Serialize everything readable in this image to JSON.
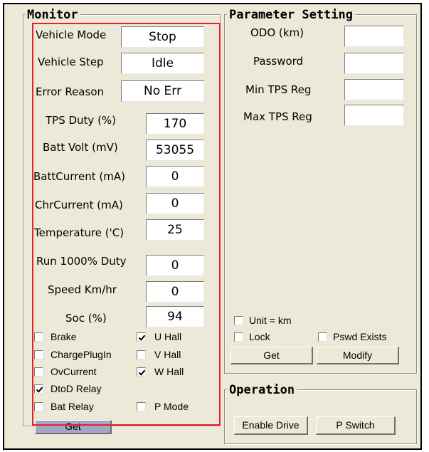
{
  "monitor": {
    "title": "Monitor",
    "fields": [
      {
        "label": "Vehicle Mode",
        "value": "Stop"
      },
      {
        "label": "Vehicle Step",
        "value": "Idle"
      },
      {
        "label": "Error Reason",
        "value": "No Err"
      },
      {
        "label": "TPS Duty (%)",
        "value": "170"
      },
      {
        "label": "Batt Volt (mV)",
        "value": "53055"
      },
      {
        "label": "BattCurrent (mA)",
        "value": "0"
      },
      {
        "label": "ChrCurrent (mA)",
        "value": "0"
      },
      {
        "label": "Temperature ('C)",
        "value": "25"
      },
      {
        "label": "Run 1000% Duty",
        "value": "0"
      },
      {
        "label": "Speed Km/hr",
        "value": "0"
      },
      {
        "label": "Soc (%)",
        "value": "94"
      }
    ],
    "checks": [
      {
        "label": "Brake",
        "checked": false
      },
      {
        "label": "U Hall",
        "checked": true
      },
      {
        "label": "ChargePlugIn",
        "checked": false
      },
      {
        "label": "V Hall",
        "checked": false
      },
      {
        "label": "OvCurrent",
        "checked": false
      },
      {
        "label": "W Hall",
        "checked": true
      },
      {
        "label": "DtoD Relay",
        "checked": true
      },
      {
        "label": "Bat Relay",
        "checked": false
      },
      {
        "label": "P Mode",
        "checked": false
      }
    ],
    "get_label": "Get"
  },
  "parameter": {
    "title": "Parameter Setting",
    "fields": [
      {
        "label": "ODO (km)",
        "value": ""
      },
      {
        "label": "Password",
        "value": ""
      },
      {
        "label": "Min TPS Reg",
        "value": ""
      },
      {
        "label": "Max TPS Reg",
        "value": ""
      }
    ],
    "checks": [
      {
        "label": "Unit = km",
        "checked": false
      },
      {
        "label": "Lock",
        "checked": false
      },
      {
        "label": "Pswd Exists",
        "checked": false
      }
    ],
    "get_label": "Get",
    "modify_label": "Modify"
  },
  "operation": {
    "title": "Operation",
    "enable_drive_label": "Enable Drive",
    "p_switch_label": "P Switch"
  },
  "colors": {
    "highlight": "#e8202a",
    "panel": "#ece9d8"
  }
}
